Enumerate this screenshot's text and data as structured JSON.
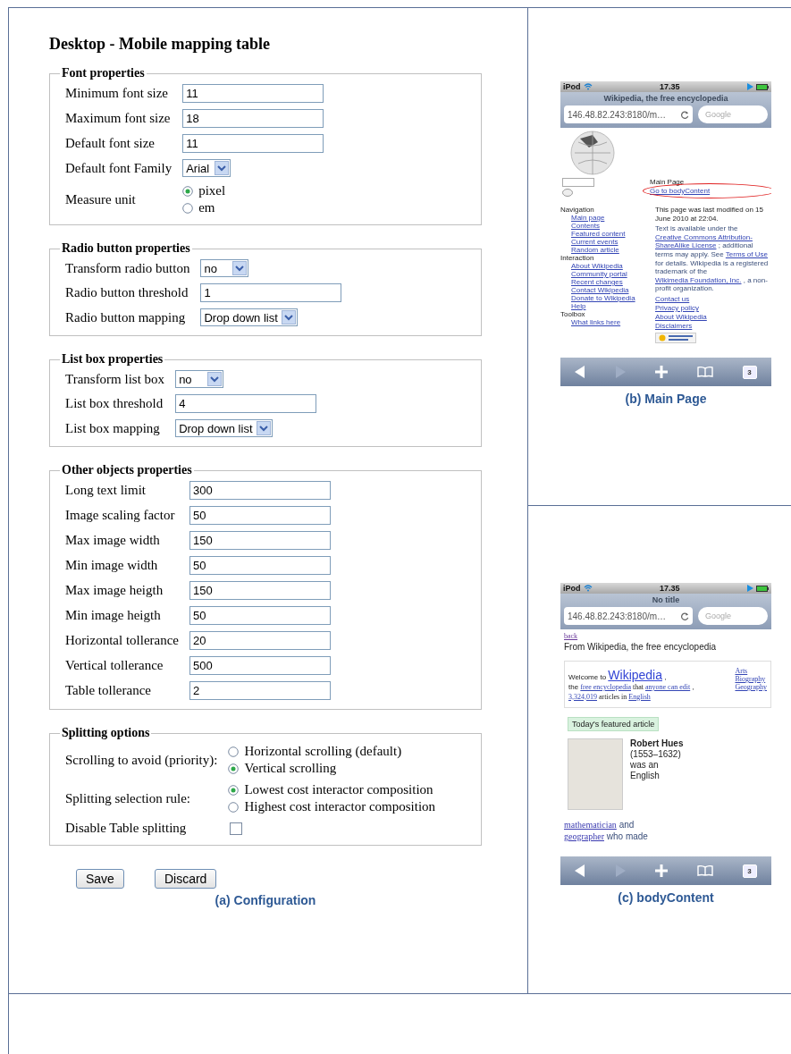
{
  "title": "Desktop - Mobile mapping table",
  "sections": [
    {
      "legend": "Font properties",
      "rows": [
        {
          "label": "Minimum font size",
          "kind": "text",
          "value": "11"
        },
        {
          "label": "Maximum font size",
          "kind": "text",
          "value": "18"
        },
        {
          "label": "Default font size",
          "kind": "text",
          "value": "11"
        },
        {
          "label": "Default font Family",
          "kind": "select",
          "value": "Arial"
        },
        {
          "label": "Measure unit",
          "kind": "radio",
          "options": [
            {
              "label": "pixel",
              "selected": true
            },
            {
              "label": "em",
              "selected": false
            }
          ]
        }
      ]
    },
    {
      "legend": "Radio button properties",
      "rows": [
        {
          "label": "Transform radio button",
          "kind": "select",
          "value": "no"
        },
        {
          "label": "Radio button threshold",
          "kind": "text",
          "value": "1"
        },
        {
          "label": "Radio button mapping",
          "kind": "select",
          "value": "Drop down list"
        }
      ]
    },
    {
      "legend": "List box properties",
      "rows": [
        {
          "label": "Transform list box",
          "kind": "select",
          "value": "no"
        },
        {
          "label": "List box threshold",
          "kind": "text",
          "value": "4"
        },
        {
          "label": "List box mapping",
          "kind": "select",
          "value": "Drop down list"
        }
      ]
    },
    {
      "legend": "Other objects properties",
      "rows": [
        {
          "label": "Long text limit",
          "kind": "text",
          "value": "300"
        },
        {
          "label": "Image scaling factor",
          "kind": "text",
          "value": "50"
        },
        {
          "label": "Max image width",
          "kind": "text",
          "value": "150"
        },
        {
          "label": "Min image width",
          "kind": "text",
          "value": "50"
        },
        {
          "label": "Max image heigth",
          "kind": "text",
          "value": "150"
        },
        {
          "label": "Min image heigth",
          "kind": "text",
          "value": "50"
        },
        {
          "label": "Horizontal tollerance",
          "kind": "text",
          "value": "20"
        },
        {
          "label": "Vertical tollerance",
          "kind": "text",
          "value": "500"
        },
        {
          "label": "Table tollerance",
          "kind": "text",
          "value": "2"
        }
      ]
    },
    {
      "legend": "Splitting options",
      "rows": [
        {
          "label": "Scrolling to avoid (priority):",
          "kind": "radio",
          "options": [
            {
              "label": "Horizontal scrolling (default)",
              "selected": false
            },
            {
              "label": "Vertical scrolling",
              "selected": true
            }
          ]
        },
        {
          "label": "Splitting selection rule:",
          "kind": "radio",
          "options": [
            {
              "label": "Lowest cost interactor composition",
              "selected": true
            },
            {
              "label": "Highest cost interactor composition",
              "selected": false
            }
          ]
        },
        {
          "label": "Disable Table splitting",
          "kind": "checkbox",
          "checked": false
        }
      ]
    }
  ],
  "buttons": [
    "Save",
    "Discard"
  ],
  "caption": "(a) Configuration",
  "phones": [
    {
      "kind": "main",
      "carrier": "iPod",
      "time": "17.35",
      "title": "Wikipedia, the free encyclopedia",
      "url": "146.48.82.243:8180/m…",
      "search_placeholder": "Google",
      "tab_count": "3",
      "caption": "(b) Main Page",
      "page": {
        "heading": "Main Page",
        "skip_link": "Go to bodyContent",
        "nav": [
          {
            "heading": "Navigation",
            "links": [
              "Main page",
              "Contents",
              "Featured content",
              "Current events",
              "Random article"
            ]
          },
          {
            "heading": "Interaction",
            "links": [
              "About Wikipedia",
              "Community portal",
              "Recent changes",
              "Contact Wikipedia",
              "Donate to Wikipedia",
              "Help"
            ]
          },
          {
            "heading": "Toolbox",
            "links": [
              "What links here"
            ]
          }
        ],
        "footer": [
          [
            {
              "text": "This page was last modified on 15 June 2010 at 22:04.",
              "kind": "text"
            }
          ],
          [
            {
              "text": "Text is available under the ",
              "kind": "text"
            },
            {
              "text": "Creative Commons Attribution-",
              "kind": "link"
            },
            {
              "text": "ShareAlike License",
              "kind": "link"
            },
            {
              "text": " ; additional terms may apply. See ",
              "kind": "text"
            },
            {
              "text": "Terms of Use",
              "kind": "link"
            },
            {
              "text": " for details. Wikipedia is a registered trademark of the ",
              "kind": "text"
            },
            {
              "text": "Wikimedia Foundation, Inc.",
              "kind": "link"
            },
            {
              "text": " , a non-profit organization.",
              "kind": "text"
            }
          ]
        ],
        "footer_links": [
          "Contact us",
          "Privacy policy",
          "About Wikipedia",
          "Disclaimers"
        ]
      }
    },
    {
      "kind": "article",
      "carrier": "iPod",
      "time": "17.35",
      "title": "No title",
      "url": "146.48.82.243:8180/m…",
      "search_placeholder": "Google",
      "tab_count": "3",
      "caption": "(c) bodyContent",
      "page": {
        "back_link": "back",
        "tagline": "From Wikipedia, the free encyclopedia",
        "welcome": [
          [
            {
              "text": "Welcome to ",
              "kind": "text"
            },
            {
              "text": "Wikipedia",
              "kind": "title-link"
            },
            {
              "text": " ,",
              "kind": "text"
            }
          ],
          [
            {
              "text": "the ",
              "kind": "text"
            },
            {
              "text": "free encyclopedia",
              "kind": "link"
            },
            {
              "text": " that ",
              "kind": "small"
            },
            {
              "text": "anyone can edit",
              "kind": "link"
            },
            {
              "text": " ,",
              "kind": "text"
            }
          ],
          [
            {
              "text": "3,324,019",
              "kind": "link"
            },
            {
              "text": " articles in ",
              "kind": "small"
            },
            {
              "text": "English",
              "kind": "link"
            }
          ]
        ],
        "portals": [
          "Arts",
          "Biography",
          "Geography"
        ],
        "featured_heading": "Today's featured article",
        "featured_text": "**Robert Hues** (1553–1632) was an English",
        "lead": [
          {
            "text": "mathematician",
            "kind": "link"
          },
          {
            "text": " and ",
            "kind": "text"
          },
          {
            "text": "geographer",
            "kind": "link"
          },
          {
            "text": " who made",
            "kind": "text"
          }
        ]
      }
    }
  ]
}
